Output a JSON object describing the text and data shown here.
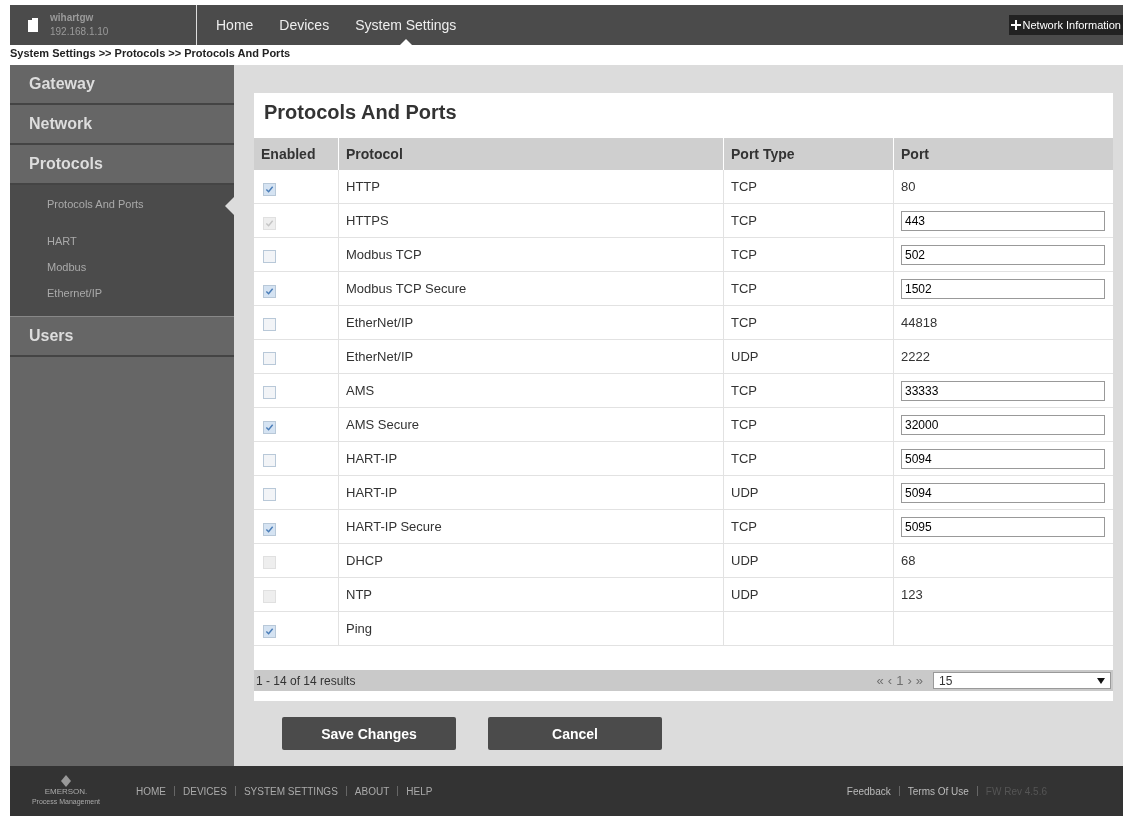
{
  "header": {
    "gateway_name": "wihartgw",
    "gateway_ip": "192.168.1.10",
    "nav": [
      {
        "label": "Home",
        "selected": false
      },
      {
        "label": "Devices",
        "selected": false
      },
      {
        "label": "System Settings",
        "selected": true
      }
    ],
    "network_info_button": "Network Information"
  },
  "breadcrumb": "System Settings >> Protocols >> Protocols And Ports",
  "sidebar": {
    "items": [
      {
        "label": "Gateway"
      },
      {
        "label": "Network"
      },
      {
        "label": "Protocols",
        "children": [
          {
            "label": "Protocols And Ports",
            "selected": true
          },
          {
            "label": "HART",
            "selected": false
          },
          {
            "label": "Modbus",
            "selected": false
          },
          {
            "label": "Ethernet/IP",
            "selected": false
          }
        ]
      },
      {
        "label": "Users"
      }
    ]
  },
  "page_title": "Protocols And Ports",
  "table": {
    "columns": [
      "Enabled",
      "Protocol",
      "Port Type",
      "Port"
    ],
    "rows": [
      {
        "checked": true,
        "disabled": false,
        "protocol": "HTTP",
        "port_type": "TCP",
        "port": "80",
        "kind": "text"
      },
      {
        "checked": true,
        "disabled": true,
        "protocol": "HTTPS",
        "port_type": "TCP",
        "port": "443",
        "kind": "input"
      },
      {
        "checked": false,
        "disabled": false,
        "protocol": "Modbus TCP",
        "port_type": "TCP",
        "port": "502",
        "kind": "input"
      },
      {
        "checked": true,
        "disabled": false,
        "protocol": "Modbus TCP Secure",
        "port_type": "TCP",
        "port": "1502",
        "kind": "input"
      },
      {
        "checked": false,
        "disabled": false,
        "protocol": "EtherNet/IP",
        "port_type": "TCP",
        "port": "44818",
        "kind": "text"
      },
      {
        "checked": false,
        "disabled": false,
        "protocol": "EtherNet/IP",
        "port_type": "UDP",
        "port": "2222",
        "kind": "text"
      },
      {
        "checked": false,
        "disabled": false,
        "protocol": "AMS",
        "port_type": "TCP",
        "port": "33333",
        "kind": "input"
      },
      {
        "checked": true,
        "disabled": false,
        "protocol": "AMS Secure",
        "port_type": "TCP",
        "port": "32000",
        "kind": "input"
      },
      {
        "checked": false,
        "disabled": false,
        "protocol": "HART-IP",
        "port_type": "TCP",
        "port": "5094",
        "kind": "input"
      },
      {
        "checked": false,
        "disabled": false,
        "protocol": "HART-IP",
        "port_type": "UDP",
        "port": "5094",
        "kind": "input"
      },
      {
        "checked": true,
        "disabled": false,
        "protocol": "HART-IP Secure",
        "port_type": "TCP",
        "port": "5095",
        "kind": "input"
      },
      {
        "checked": false,
        "disabled": true,
        "protocol": "DHCP",
        "port_type": "UDP",
        "port": "68",
        "kind": "text"
      },
      {
        "checked": false,
        "disabled": true,
        "protocol": "NTP",
        "port_type": "UDP",
        "port": "123",
        "kind": "text"
      },
      {
        "checked": true,
        "disabled": false,
        "protocol": "Ping",
        "kind": "text"
      }
    ]
  },
  "pagination": {
    "summary": "1 - 14 of 14 results",
    "first": "«",
    "prev": "‹",
    "page": "1",
    "next": "›",
    "last": "»",
    "page_size": "15"
  },
  "buttons": [
    "Save Changes",
    "Cancel"
  ],
  "footer": {
    "logo": "EMERSON.",
    "logo_sub": "Process Management",
    "links": [
      "HOME",
      "DEVICES",
      "SYSTEM SETTINGS",
      "ABOUT",
      "HELP"
    ],
    "right_links": [
      "Feedback",
      "Terms Of Use"
    ],
    "version": "FW Rev 4.5.6"
  }
}
